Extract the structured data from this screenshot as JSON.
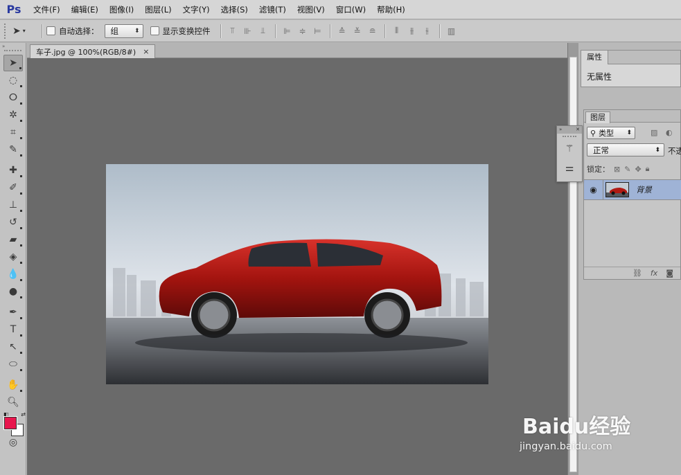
{
  "app": {
    "logo": "Ps"
  },
  "menu": [
    "文件(F)",
    "编辑(E)",
    "图像(I)",
    "图层(L)",
    "文字(Y)",
    "选择(S)",
    "滤镜(T)",
    "视图(V)",
    "窗口(W)",
    "帮助(H)"
  ],
  "options_bar": {
    "auto_select_label": "自动选择：",
    "auto_select_value": "组",
    "show_transform_label": "显示变换控件"
  },
  "document": {
    "tab_title": "车子.jpg @ 100%(RGB/8#)",
    "close_glyph": "×"
  },
  "properties_panel": {
    "tab": "属性",
    "body": "无属性"
  },
  "layers_panel": {
    "tab": "图层",
    "filter_label": "类型",
    "blend_mode": "正常",
    "opacity_label": "不透",
    "lock_label": "锁定：",
    "layers": [
      {
        "name": "背景",
        "visible": true,
        "selected": true
      }
    ]
  },
  "colors": {
    "foreground": "#e8174e",
    "background": "#ffffff",
    "canvas_bg": "#6a6a6a",
    "selected_layer": "#9fb3d6"
  },
  "watermark": {
    "brand": "Baidu经验",
    "url": "jingyan.baidu.com"
  }
}
